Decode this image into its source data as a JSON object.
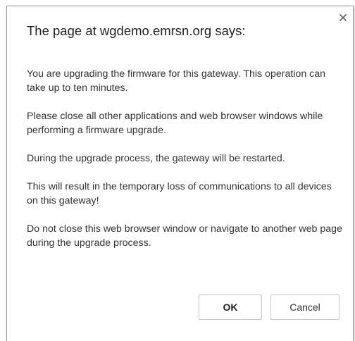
{
  "dialog": {
    "title": "The page at wgdemo.emrsn.org says:",
    "close_icon": "close-icon",
    "paragraphs": [
      "You are upgrading the firmware for this gateway. This operation can take up to ten minutes.",
      "Please close all other applications and web browser windows while performing a firmware upgrade.",
      "During the upgrade process, the gateway will be restarted.",
      "This will result in the temporary loss of communications to all devices on this gateway!",
      "Do not close this web browser window or navigate to another web page during the upgrade process."
    ],
    "ok_label": "OK",
    "cancel_label": "Cancel"
  }
}
